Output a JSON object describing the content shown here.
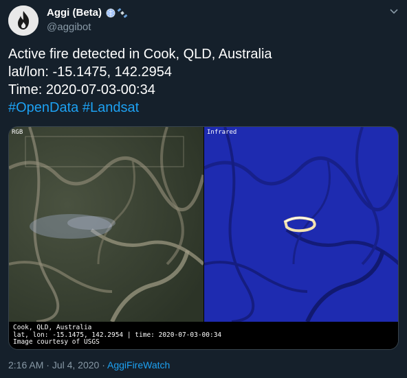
{
  "author": {
    "name": "Aggi (Beta)",
    "handle": "@aggibot"
  },
  "tweet": {
    "line1": "Active fire detected in Cook, QLD, Australia",
    "line2": "lat/lon: -15.1475, 142.2954",
    "line3": "Time: 2020-07-03-00:34",
    "hashtag1": "#OpenData",
    "hashtag2": "#Landsat"
  },
  "media": {
    "rgb_label": "RGB",
    "infrared_label": "Infrared",
    "caption_line1": "Cook, QLD, Australia",
    "caption_line2": "lat, lon: -15.1475, 142.2954 | time: 2020-07-03-00:34",
    "caption_line3": "Image courtesy of USGS"
  },
  "meta": {
    "time": "2:16 AM",
    "separator1": " · ",
    "date": "Jul 4, 2020",
    "separator2": " · ",
    "source": "AggiFireWatch"
  },
  "colors": {
    "background": "#15202b",
    "link": "#1da1f2",
    "muted": "#8899a6",
    "infrared": "#1e2bb0"
  }
}
